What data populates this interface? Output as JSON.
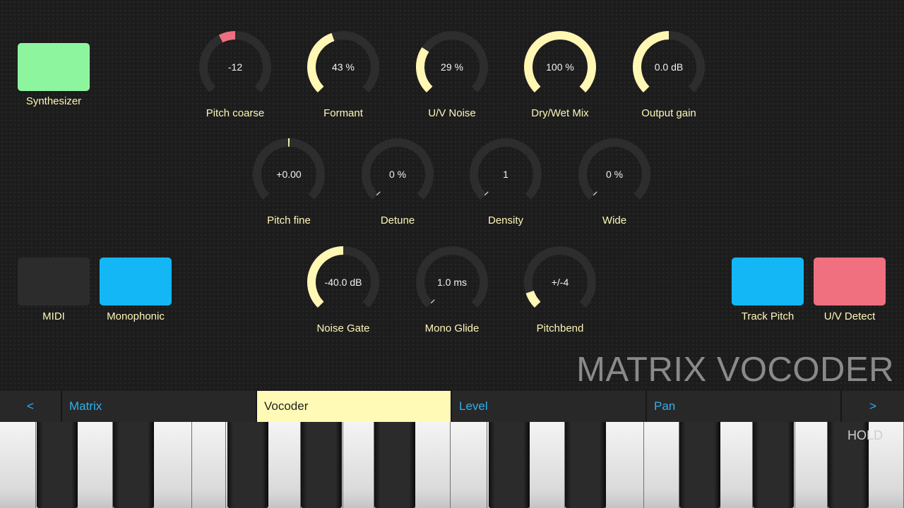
{
  "brand_title": "MATRIX VOCODER",
  "hold_label": "HOLD",
  "colors": {
    "label_text": "#fff7b8",
    "arc_track": "#2d2d2d",
    "arc_fill": "#fff7b3",
    "arc_fill_negative": "#ee6f82",
    "accent_blue": "#2fb1f0"
  },
  "pads": {
    "synthesizer": {
      "label": "Synthesizer",
      "color": "#8ef59f"
    },
    "midi": {
      "label": "MIDI",
      "color": "#2c2c2c"
    },
    "monophonic": {
      "label": "Monophonic",
      "color": "#14b7f5"
    },
    "track_pitch": {
      "label": "Track Pitch",
      "color": "#14b7f5"
    },
    "uv_detect": {
      "label": "U/V Detect",
      "color": "#f0707f"
    }
  },
  "knobs": {
    "pitch_coarse": {
      "label": "Pitch coarse",
      "value": "-12",
      "mode": "bipolar",
      "amount": -0.2
    },
    "formant": {
      "label": "Formant",
      "value": "43 %",
      "mode": "unipolar",
      "amount": 0.43
    },
    "uv_noise": {
      "label": "U/V Noise",
      "value": "29 %",
      "mode": "unipolar",
      "amount": 0.29
    },
    "dry_wet_mix": {
      "label": "Dry/Wet Mix",
      "value": "100 %",
      "mode": "unipolar",
      "amount": 1.0
    },
    "output_gain": {
      "label": "Output gain",
      "value": "0.0 dB",
      "mode": "unipolar",
      "amount": 0.5
    },
    "pitch_fine": {
      "label": "Pitch fine",
      "value": "+0.00",
      "mode": "bipolar",
      "amount": 0.0
    },
    "detune": {
      "label": "Detune",
      "value": "0 %",
      "mode": "unipolar",
      "amount": 0.0
    },
    "density": {
      "label": "Density",
      "value": "1",
      "mode": "unipolar",
      "amount": 0.0
    },
    "wide": {
      "label": "Wide",
      "value": "0 %",
      "mode": "unipolar",
      "amount": 0.0
    },
    "noise_gate": {
      "label": "Noise Gate",
      "value": "-40.0 dB",
      "mode": "unipolar",
      "amount": 0.5
    },
    "mono_glide": {
      "label": "Mono Glide",
      "value": "1.0 ms",
      "mode": "unipolar",
      "amount": 0.0
    },
    "pitchbend": {
      "label": "Pitchbend",
      "value": "+/-4",
      "mode": "unipolar",
      "amount": 0.1
    }
  },
  "tabs": {
    "prev": "<",
    "matrix": "Matrix",
    "vocoder": "Vocoder",
    "level": "Level",
    "pan": "Pan",
    "next": ">"
  }
}
